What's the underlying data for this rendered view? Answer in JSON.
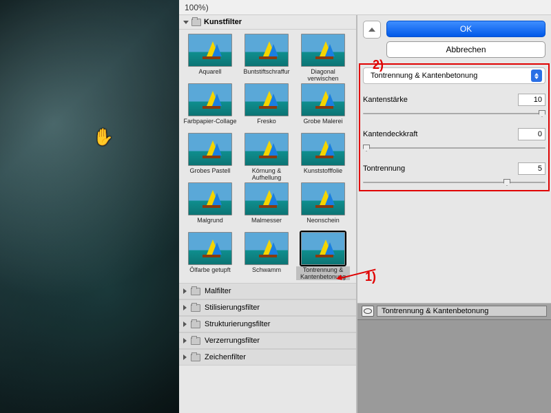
{
  "window": {
    "title_suffix": "100%)"
  },
  "gallery": {
    "open_category": "Kunstfilter",
    "filters": [
      {
        "label": "Aquarell"
      },
      {
        "label": "Buntstiftschraffur"
      },
      {
        "label": "Diagonal verwischen"
      },
      {
        "label": "Farbpapier-Collage"
      },
      {
        "label": "Fresko"
      },
      {
        "label": "Grobe Malerei"
      },
      {
        "label": "Grobes Pastell"
      },
      {
        "label": "Körnung & Aufhellung"
      },
      {
        "label": "Kunststofffolie"
      },
      {
        "label": "Malgrund"
      },
      {
        "label": "Malmesser"
      },
      {
        "label": "Neonschein"
      },
      {
        "label": "Ölfarbe getupft"
      },
      {
        "label": "Schwamm"
      },
      {
        "label": "Tontrennung & Kantenbetonung",
        "selected": true
      }
    ],
    "collapsed_categories": [
      "Malfilter",
      "Stilisierungsfilter",
      "Strukturierungsfilter",
      "Verzerrungsfilter",
      "Zeichenfilter"
    ]
  },
  "panel": {
    "ok_label": "OK",
    "cancel_label": "Abbrechen",
    "filter_select": "Tontrennung & Kantenbetonung",
    "params": {
      "p1": {
        "label": "Kantenstärke",
        "value": "10",
        "pos": 100
      },
      "p2": {
        "label": "Kantendeckkraft",
        "value": "0",
        "pos": 0
      },
      "p3": {
        "label": "Tontrennung",
        "value": "5",
        "pos": 80
      }
    }
  },
  "layers": {
    "active": "Tontrennung & Kantenbetonung"
  },
  "annotations": {
    "a1": "1)",
    "a2": "2)"
  }
}
